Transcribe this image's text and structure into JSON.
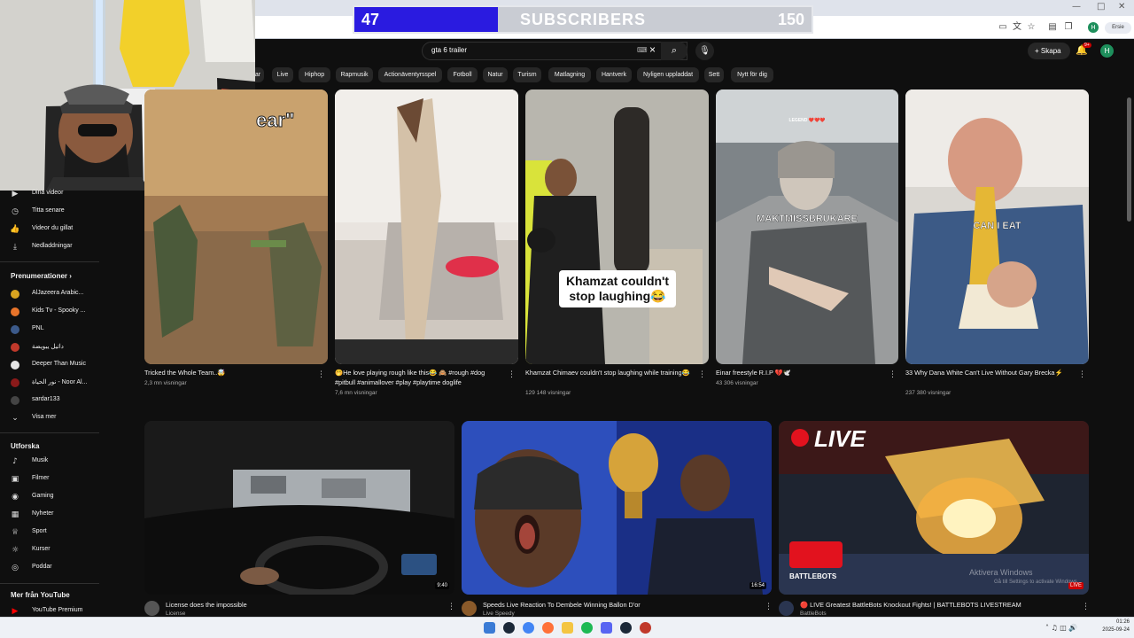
{
  "overlay": {
    "current": "47",
    "label": "SUBSCRIBERS",
    "goal": "150",
    "progress_fraction": 0.3133
  },
  "browser": {
    "window_controls": [
      "—",
      "□",
      "✕"
    ],
    "profile_label": "Ersie"
  },
  "header": {
    "search_value": "gta 6 trailer",
    "create_label": "Skapa",
    "notification_count": "9+",
    "avatar_letter": "H"
  },
  "chips": [
    "ar",
    "Live",
    "Hiphop",
    "Rapmusik",
    "Actionäventyrsspel",
    "Fotboll",
    "Natur",
    "Turism",
    "Matlagning",
    "Hantverk",
    "Nyligen uppladdat",
    "Sett",
    "Nytt för dig"
  ],
  "sidebar": {
    "you_items": [
      "Dina videor",
      "Titta senare",
      "Videor du gillat",
      "Nedladdningar"
    ],
    "subscriptions_heading": "Prenumerationer",
    "subscriptions": [
      "AlJazeera Arabic...",
      "Kids Tv - Spooky ...",
      "PNL",
      "داتيل يبويضة",
      "Deeper Than Music",
      "نور الحياة - Noor Al...",
      "sardar133"
    ],
    "show_more": "Visa mer",
    "explore_heading": "Utforska",
    "explore_items": [
      "Musik",
      "Filmer",
      "Gaming",
      "Nyheter",
      "Sport",
      "Kurser",
      "Poddar"
    ],
    "more_heading": "Mer från YouTube",
    "more_items": [
      "YouTube Premium"
    ]
  },
  "shorts": [
    {
      "overlay": "ear\"",
      "title": "Tricked the Whole Team..🤯",
      "meta": "2,3 mn visningar"
    },
    {
      "overlay": "",
      "title": "🤭He love playing rough like this😂 🙈 #rough #dog #pitbull #animallover #play #playtime doglife",
      "meta": "7,6 mn visningar"
    },
    {
      "overlay": "Khamzat couldn't stop laughing😂",
      "title": "Khamzat Chimaev couldn't stop laughing while training😂",
      "meta": "129 148 visningar"
    },
    {
      "overlay": "MAKTMISSBRUKARE",
      "overlay2": "LEGEND ❤️❤️❤️",
      "title": "Einar freestyle R.I.P 💔🕊️",
      "meta": "43 306 visningar"
    },
    {
      "overlay": "CAN I EAT",
      "title": "33 Why Dana White Can't Live Without Gary Brecka⚡",
      "meta": "237 380 visningar"
    }
  ],
  "videos": [
    {
      "title": "License does the impossible",
      "channel": "License",
      "duration": "9:40"
    },
    {
      "title": "Speeds Live Reaction To Dembele Winning Ballon D'or",
      "channel": "Live Speedy",
      "duration": "16:54"
    },
    {
      "title": "🔴 LIVE Greatest BattleBots Knockout Fights! | BATTLEBOTS LIVESTREAM",
      "channel": "BattleBots",
      "badge": "LIVE",
      "live_text": "LIVE",
      "logo_text": "BATTLEBOTS"
    }
  ],
  "watermark": {
    "line1": "Aktivera Windows",
    "line2": "Gå till Settings to activate Windows."
  },
  "clock": {
    "time": "01:26",
    "date": "2025-09-24"
  },
  "colors": {
    "subscriber_fill": "#2a1be0",
    "live_red": "#cc0000",
    "background": "#0f0f0f"
  }
}
